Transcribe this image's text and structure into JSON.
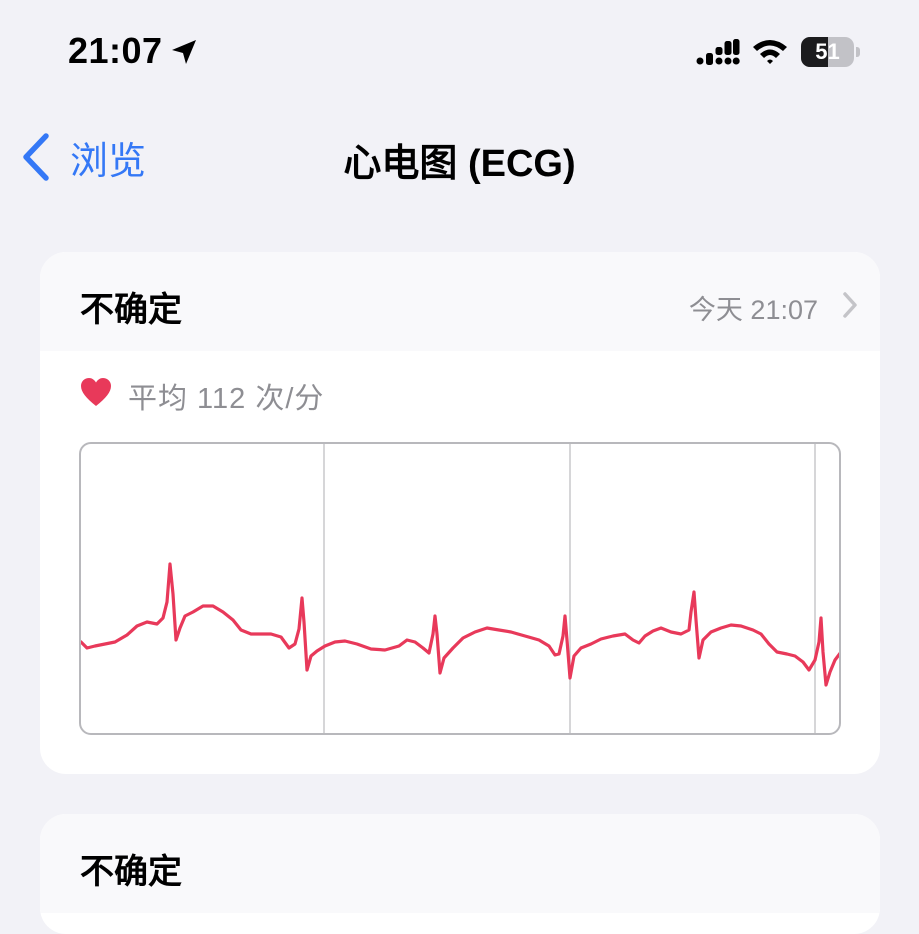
{
  "status_bar": {
    "time": "21:07",
    "battery_level": "51",
    "battery_fraction": 0.51,
    "icons": [
      "location-arrow-icon",
      "cellular-signal-icon",
      "wifi-icon",
      "battery-icon"
    ]
  },
  "nav": {
    "back_label": "浏览",
    "title": "心电图 (ECG)",
    "accent_color": "#3478f6"
  },
  "recordings": [
    {
      "classification": "不确定",
      "timestamp": "今天 21:07",
      "heart_rate_label": "平均 112 次/分",
      "heart_icon": "heart-icon",
      "trace_color": "#e8395a"
    },
    {
      "classification": "不确定"
    }
  ]
}
